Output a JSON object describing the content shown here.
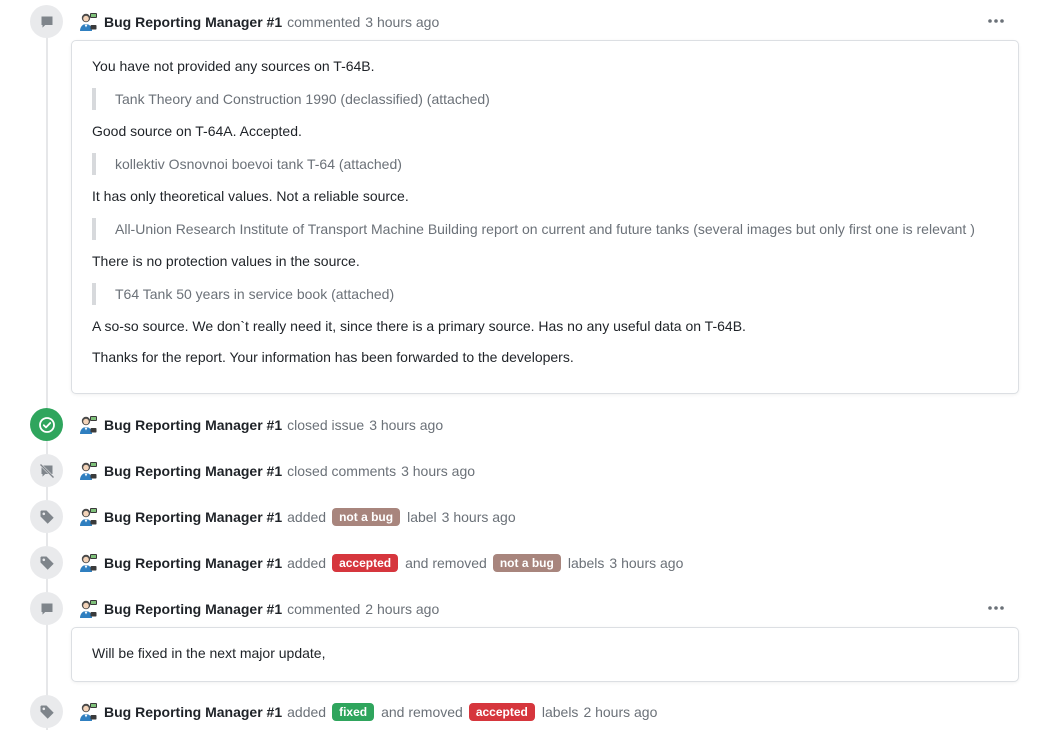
{
  "colors": {
    "accepted": "#d6363d",
    "not_a_bug": "#a8857d",
    "fixed": "#2fa55d",
    "closed_badge": "#2fa55d"
  },
  "events": [
    {
      "type": "comment",
      "icon": "comment-icon",
      "author": "Bug Reporting Manager #1",
      "action": "commented",
      "time": "3 hours ago",
      "body": [
        {
          "kind": "p",
          "text": "You have not provided any sources on T-64B."
        },
        {
          "kind": "quote",
          "text": "Tank Theory and Construction 1990 (declassified) (attached)"
        },
        {
          "kind": "p",
          "text": "Good source on T-64A. Accepted."
        },
        {
          "kind": "quote",
          "text": "kollektiv Osnovnoi boevoi tank T-64 (attached)"
        },
        {
          "kind": "p",
          "text": "It has only theoretical values. Not a reliable source."
        },
        {
          "kind": "quote",
          "text": "All-Union Research Institute of Transport Machine Building report on current and future tanks (several images but only first one is relevant )"
        },
        {
          "kind": "p",
          "text": "There is no protection values in the source."
        },
        {
          "kind": "quote",
          "text": "T64 Tank 50 years in service book (attached)"
        },
        {
          "kind": "p",
          "text": "A so-so source. We don`t really need it, since there is a primary source. Has no any useful data on T-64B."
        },
        {
          "kind": "p",
          "text": "Thanks for the report. Your information has been forwarded to the developers."
        }
      ]
    },
    {
      "type": "closed",
      "icon": "check-circle-icon",
      "author": "Bug Reporting Manager #1",
      "action": "closed issue",
      "time": "3 hours ago"
    },
    {
      "type": "comments-closed",
      "icon": "comment-off-icon",
      "author": "Bug Reporting Manager #1",
      "action": "closed comments",
      "time": "3 hours ago"
    },
    {
      "type": "label",
      "icon": "tag-icon",
      "author": "Bug Reporting Manager #1",
      "action": "added",
      "label1": "not a bug",
      "tail": "label",
      "time": "3 hours ago"
    },
    {
      "type": "label-swap",
      "icon": "tag-icon",
      "author": "Bug Reporting Manager #1",
      "action": "added",
      "label1": "accepted",
      "mid": "and removed",
      "label2": "not a bug",
      "tail": "labels",
      "time": "3 hours ago"
    },
    {
      "type": "comment",
      "icon": "comment-icon",
      "author": "Bug Reporting Manager #1",
      "action": "commented",
      "time": "2 hours ago",
      "body": [
        {
          "kind": "p",
          "text": "Will be fixed in the next major update,"
        }
      ]
    },
    {
      "type": "label-swap",
      "icon": "tag-icon",
      "author": "Bug Reporting Manager #1",
      "action": "added",
      "label1": "fixed",
      "mid": "and removed",
      "label2": "accepted",
      "tail": "labels",
      "time": "2 hours ago"
    }
  ]
}
